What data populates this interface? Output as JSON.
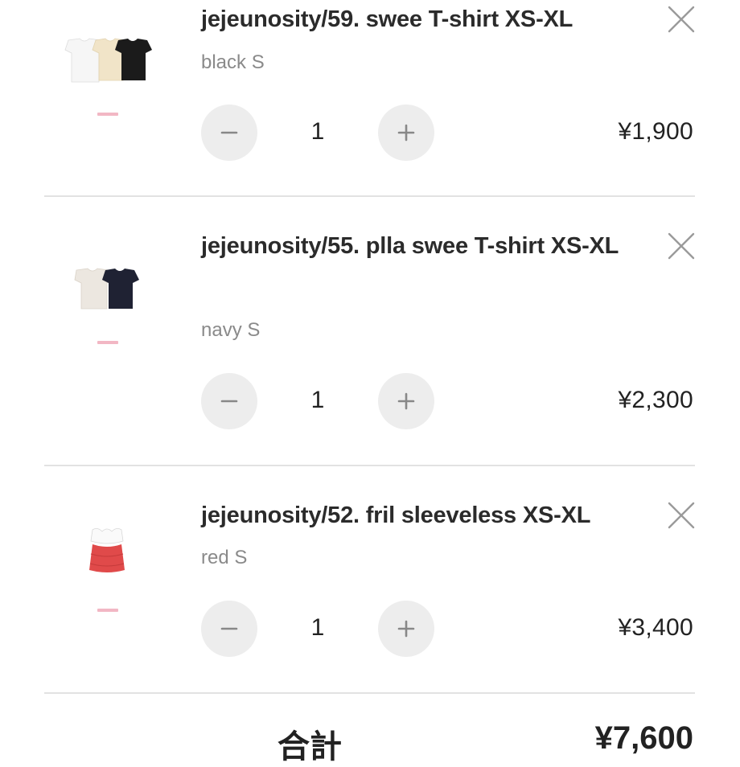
{
  "cart": {
    "items": [
      {
        "title": "jejeunosity/59. swee T-shirt XS-XL",
        "variant": "black S",
        "quantity": "1",
        "price": "¥1,900",
        "image": "tshirt-white-beige-black"
      },
      {
        "title": "jejeunosity/55. plla swee T-shirt XS-XL",
        "variant": "navy S",
        "quantity": "1",
        "price": "¥2,300",
        "image": "tshirt-ivory-navy"
      },
      {
        "title": "jejeunosity/52. fril sleeveless XS-XL",
        "variant": "red S",
        "quantity": "1",
        "price": "¥3,400",
        "image": "red-fril-sleeveless"
      }
    ],
    "total": {
      "label": "合計",
      "value": "¥7,600"
    }
  },
  "icons": {
    "remove": "close-icon",
    "decrement": "minus-icon",
    "increment": "plus-icon"
  },
  "colors": {
    "button_bg": "#ededed",
    "divider": "#e2e2e2",
    "variant_text": "#8a8a8a",
    "product_red": "#e04a4a"
  }
}
